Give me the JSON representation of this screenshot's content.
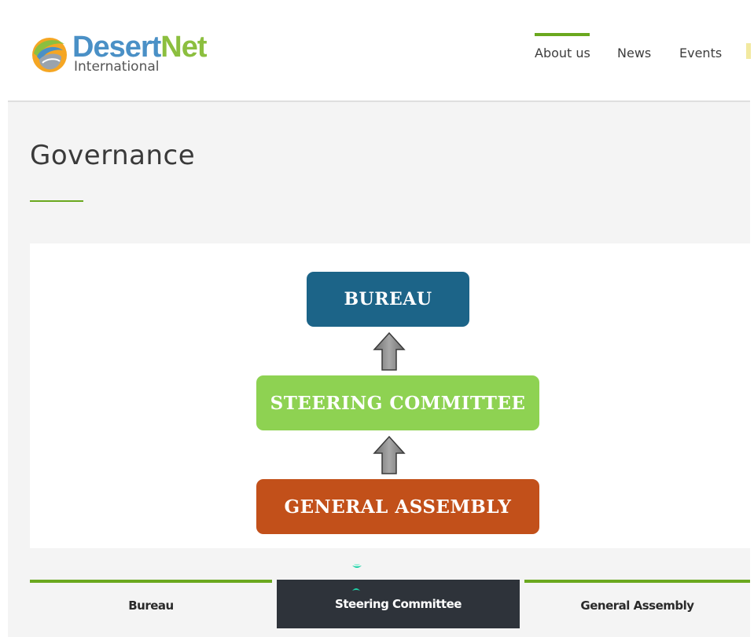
{
  "brand": {
    "name_part1": "Desert",
    "name_part2": "Net",
    "subtitle": "International",
    "colors": {
      "blue": "#4a90c6",
      "green": "#8cbf3f"
    }
  },
  "nav": {
    "items": [
      {
        "label": "About us",
        "active": true
      },
      {
        "label": "News",
        "active": false
      },
      {
        "label": "Events",
        "active": false
      }
    ],
    "accent": "#6aa81e"
  },
  "page": {
    "title": "Governance"
  },
  "diagram": {
    "boxes": [
      {
        "label": "BUREAU",
        "color": "#1c6488"
      },
      {
        "label": "STEERING COMMITTEE",
        "color": "#8ed252"
      },
      {
        "label": "GENERAL ASSEMBLY",
        "color": "#c2501a"
      }
    ],
    "arrow_icon": "up-arrow-icon"
  },
  "tabs": {
    "items": [
      {
        "label": "Bureau",
        "active": false
      },
      {
        "label": "Steering Committee",
        "active": true
      },
      {
        "label": "General Assembly",
        "active": false
      }
    ],
    "active_bg": "#2e333a",
    "marker_color": "#1fd3a8"
  }
}
